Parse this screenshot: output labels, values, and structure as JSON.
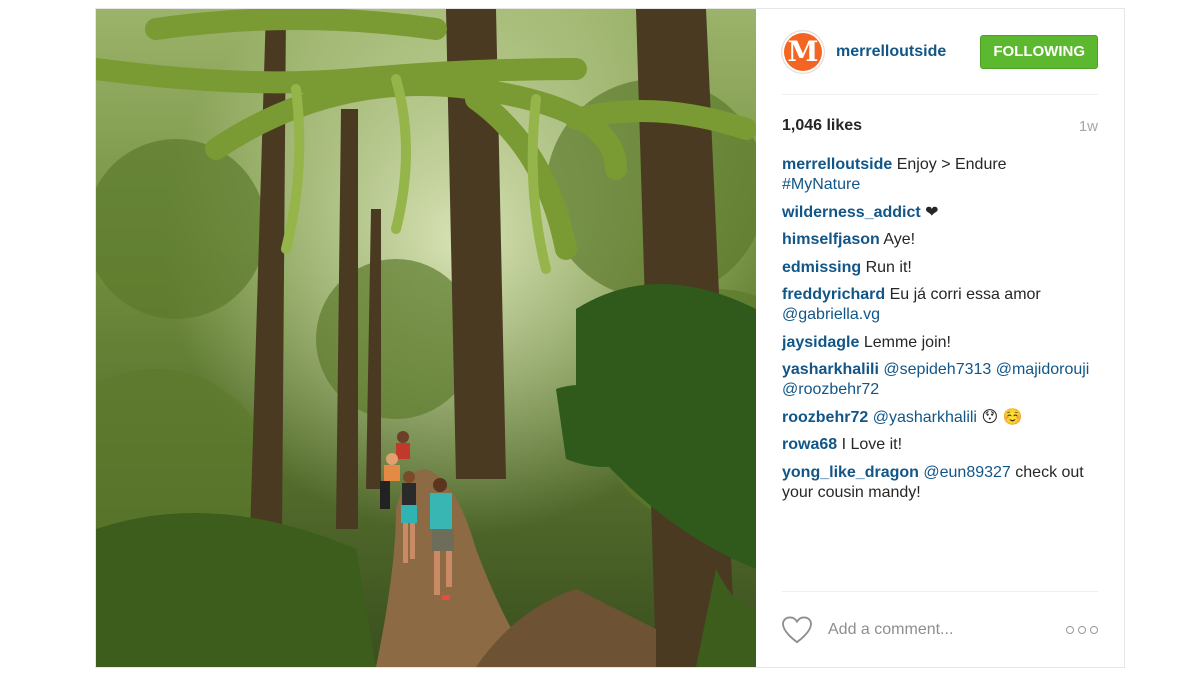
{
  "post": {
    "username": "merrelloutside",
    "avatar_letter": "M",
    "follow_label": "FOLLOWING",
    "likes": "1,046 likes",
    "time": "1w",
    "caption": {
      "user": "merrelloutside",
      "text": "Enjoy > Endure",
      "hashtag": "#MyNature"
    },
    "comments": [
      {
        "user": "wilderness_addict",
        "text": "❤"
      },
      {
        "user": "himselfjason",
        "text": "Aye!"
      },
      {
        "user": "edmissing",
        "text": "Run it!"
      },
      {
        "user": "freddyrichard",
        "text": "Eu já corri essa amor",
        "mention": "@gabriella.vg"
      },
      {
        "user": "jaysidagle",
        "text": "Lemme join!"
      },
      {
        "user": "yasharkhalili",
        "mention": "@sepideh7313 @majidorouji @roozbehr72"
      },
      {
        "user": "roozbehr72",
        "mention": "@yasharkhalili",
        "text": "😯 ☺️"
      },
      {
        "user": "rowa68",
        "text": "I Love it!"
      },
      {
        "user": "yong_like_dragon",
        "mention": "@eun89327",
        "text": "check out your cousin mandy!"
      }
    ],
    "comment_placeholder": "Add a comment...",
    "more_icon": "ellipsis-icon",
    "like_icon": "heart-icon"
  },
  "colors": {
    "accent_blue": "#125688",
    "follow_green": "#5cb82e",
    "avatar_orange": "#f26522"
  }
}
